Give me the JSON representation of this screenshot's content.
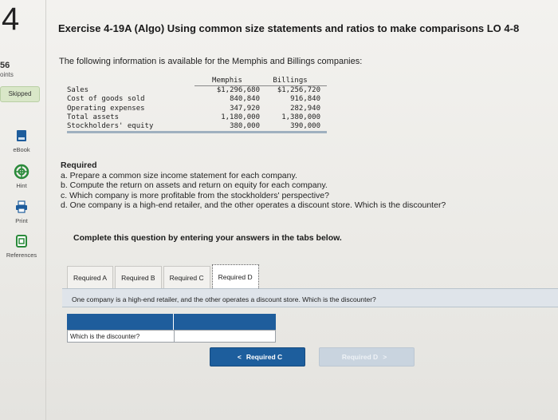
{
  "question": {
    "number": "4",
    "points": "56",
    "points_label": "oints",
    "status": "Skipped",
    "title": "Exercise 4-19A (Algo) Using common size statements and ratios to make comparisons LO 4-8",
    "intro": "The following information is available for the Memphis and Billings companies:"
  },
  "sidebar": {
    "tools": [
      {
        "label": "eBook",
        "icon": "ebook-icon"
      },
      {
        "label": "Hint",
        "icon": "hint-icon"
      },
      {
        "label": "Print",
        "icon": "print-icon"
      },
      {
        "label": "References",
        "icon": "references-icon"
      }
    ]
  },
  "data_table": {
    "headers": [
      "Memphis",
      "Billings"
    ],
    "rows": [
      {
        "label": "Sales",
        "memphis": "$1,296,680",
        "billings": "$1,256,720"
      },
      {
        "label": "Cost of goods sold",
        "memphis": "840,840",
        "billings": "916,840"
      },
      {
        "label": "Operating expenses",
        "memphis": "347,920",
        "billings": "282,940"
      },
      {
        "label": "Total assets",
        "memphis": "1,180,000",
        "billings": "1,380,000"
      },
      {
        "label": "Stockholders' equity",
        "memphis": "380,000",
        "billings": "390,000"
      }
    ]
  },
  "required": {
    "title": "Required",
    "items": [
      "a. Prepare a common size income statement for each company.",
      "b. Compute the return on assets and return on equity for each company.",
      "c. Which company is more profitable from the stockholders' perspective?",
      "d. One company is a high-end retailer, and the other operates a discount store. Which is the discounter?"
    ]
  },
  "instruction": "Complete this question by entering your answers in the tabs below.",
  "tabs": [
    "Required A",
    "Required B",
    "Required C",
    "Required D"
  ],
  "active_tab": "Required D",
  "banner": "One company is a high-end retailer, and the other operates a discount store. Which is the discounter?",
  "answer": {
    "label": "Which is the discounter?",
    "value": ""
  },
  "nav": {
    "prev_label": "Required C",
    "next_label": "Required D",
    "prev_chevron": "<",
    "next_chevron": ">"
  },
  "colors": {
    "primary": "#1d5e9d",
    "disabled": "#c9d4df",
    "skipped_badge": "#d9e7c8"
  }
}
